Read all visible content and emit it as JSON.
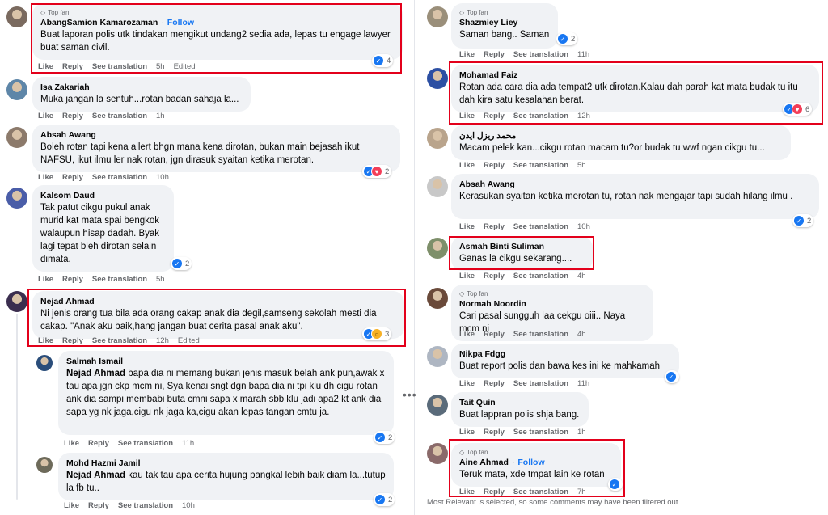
{
  "common": {
    "like": "Like",
    "reply": "Reply",
    "see_translation": "See translation",
    "top_fan": "Top fan",
    "follow": "Follow",
    "edited": "Edited",
    "dot": "·"
  },
  "left": [
    {
      "name": "AbangSamion Kamarozaman",
      "top_fan": true,
      "follow": true,
      "text": "Buat laporan polis utk tindakan mengikut undang2 sedia ada, lepas tu engage lawyer buat saman civil.",
      "time": "5h",
      "edited": true,
      "reactions": [
        "like"
      ],
      "count": "4"
    },
    {
      "name": "Isa Zakariah",
      "text": "Muka jangan la sentuh...rotan badan sahaja la...",
      "time": "1h"
    },
    {
      "name": "Absah Awang",
      "text": "Boleh rotan tapi kena allert bhgn mana kena dirotan, bukan main bejasah ikut NAFSU, ikut ilmu ler nak rotan, jgn dirasuk syaitan ketika merotan.",
      "time": "10h",
      "reactions": [
        "like",
        "love"
      ],
      "count": "2"
    },
    {
      "name": "Kalsom Daud",
      "text": "Tak patut cikgu pukul anak murid kat mata spai bengkok walaupun hisap dadah. Byak lagi tepat bleh dirotan selain dimata.",
      "time": "5h",
      "reactions": [
        "like"
      ],
      "count": "2"
    },
    {
      "name": "Nejad Ahmad",
      "text": "Ni jenis orang tua bila ada orang cakap anak dia degil,samseng sekolah mesti dia cakap. \"Anak aku baik,hang jangan buat cerita pasal anak aku\".",
      "time": "12h",
      "edited": true,
      "reactions": [
        "like",
        "wow"
      ],
      "count": "3"
    },
    {
      "name": "Salmah Ismail",
      "mention": "Nejad Ahmad",
      "text": " bapa dia ni memang bukan jenis masuk belah ank pun,awak x tau apa jgn ckp mcm ni, Sya kenai sngt dgn bapa dia ni tpi klu dh cigu rotan ank dia sampi membabi buta cmni sapa x marah sbb klu jadi apa2 kt ank dia sapa yg nk jaga,cigu nk jaga ka,cigu akan lepas tangan cmtu ja.",
      "time": "11h",
      "reactions": [
        "like"
      ],
      "count": "2"
    },
    {
      "name": "Mohd Hazmi Jamil",
      "mention": "Nejad Ahmad",
      "text": " kau tak tau apa cerita hujung pangkal lebih baik diam la...tutup la fb tu..",
      "time": "10h",
      "reactions": [
        "like"
      ],
      "count": "2"
    }
  ],
  "right": [
    {
      "name": "Shazmiey Liey",
      "top_fan": true,
      "text": "Saman bang.. Saman",
      "time": "11h",
      "reactions": [
        "like"
      ],
      "count": "2"
    },
    {
      "name": "Mohamad Faiz",
      "text": "Rotan ada cara dia ada tempat2 utk dirotan.Kalau dah parah kat mata budak tu itu dah kira satu kesalahan berat.",
      "time": "12h",
      "reactions": [
        "like",
        "love"
      ],
      "count": "6"
    },
    {
      "name": "محمد ريزل ايدن",
      "text": "Macam pelek kan...cikgu rotan macam tu?or budak tu wwf ngan cikgu tu...",
      "time": "5h"
    },
    {
      "name": "Absah Awang",
      "text": "Kerasukan syaitan ketika merotan tu, rotan nak mengajar tapi sudah hilang ilmu .",
      "time": "10h",
      "reactions": [
        "like"
      ],
      "count": "2"
    },
    {
      "name": "Asmah Binti Suliman",
      "text": "Ganas la cikgu sekarang....",
      "time": "4h"
    },
    {
      "name": "Normah Noordin",
      "top_fan": true,
      "text": "Cari pasal sungguh laa cekgu oiii.. Naya mcm ni",
      "time": "4h"
    },
    {
      "name": "Nikpa Fdgg",
      "text": "Buat report polis dan bawa kes ini ke mahkamah",
      "time": "11h",
      "reactions": [
        "like"
      ],
      "count": ""
    },
    {
      "name": "Tait Quin",
      "text": "Buat lappran polis shja bang.",
      "time": "1h"
    },
    {
      "name": "Aine Ahmad",
      "top_fan": true,
      "follow": true,
      "text": "Teruk mata, xde tmpat lain ke rotan",
      "time": "7h",
      "reactions": [
        "like"
      ],
      "count": ""
    }
  ],
  "footer_note": "Most Relevant is selected, so some comments may have been filtered out.",
  "colors": {
    "highlight": "#e3001b",
    "bubble": "#f0f2f5",
    "link": "#1877f2"
  }
}
